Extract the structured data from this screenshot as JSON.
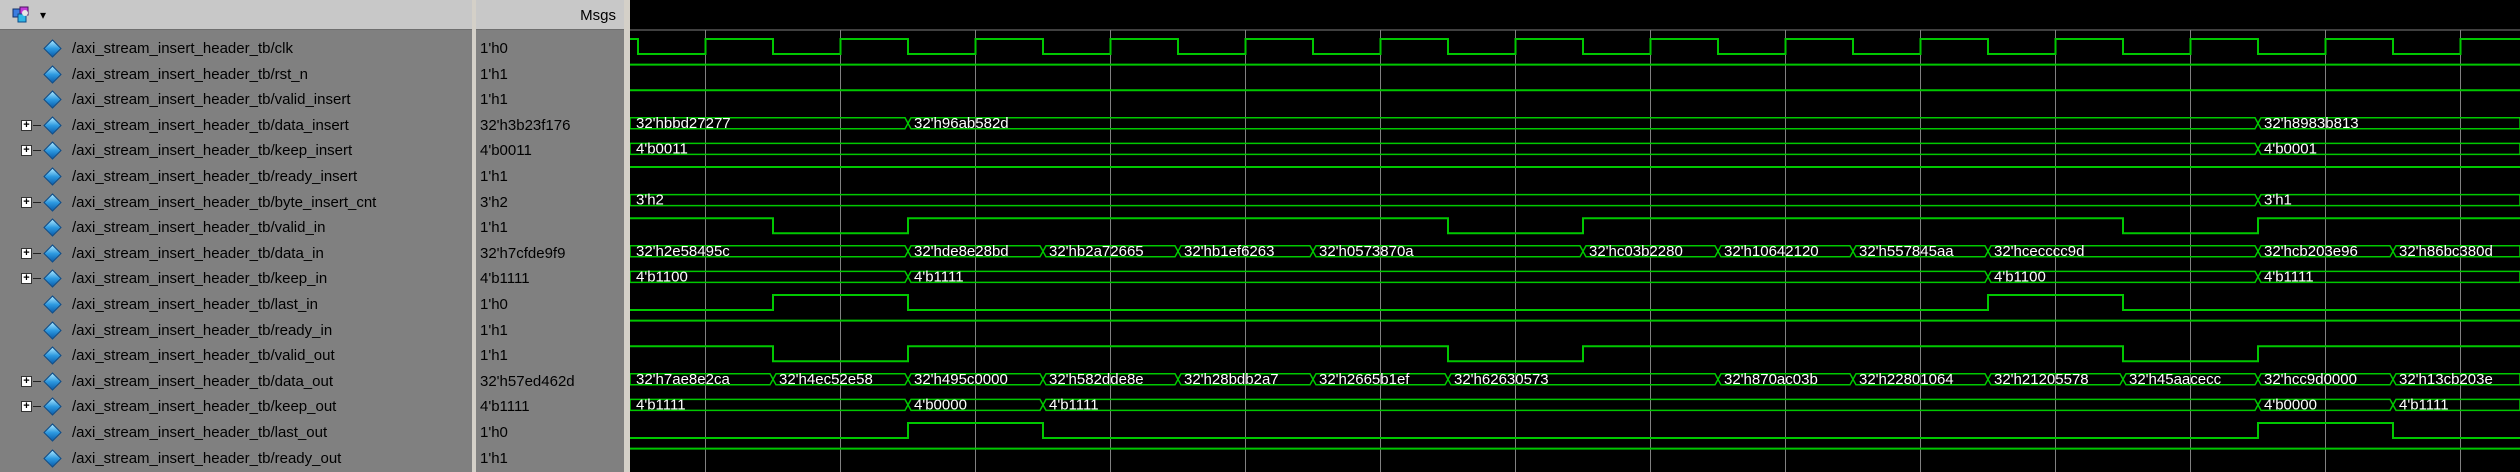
{
  "header": {
    "msgs_label": "Msgs"
  },
  "colors": {
    "wave": "#00c800",
    "grid": "#808080",
    "label": "#ffffff"
  },
  "icons": {
    "header": "wave-window-icon",
    "signal": "signal-diamond-icon",
    "expand": "expand-plus-icon"
  },
  "signals": [
    {
      "name": "/axi_stream_insert_header_tb/clk",
      "value": "1'h0",
      "bus": false
    },
    {
      "name": "/axi_stream_insert_header_tb/rst_n",
      "value": "1'h1",
      "bus": false
    },
    {
      "name": "/axi_stream_insert_header_tb/valid_insert",
      "value": "1'h1",
      "bus": false
    },
    {
      "name": "/axi_stream_insert_header_tb/data_insert",
      "value": "32'h3b23f176",
      "bus": true
    },
    {
      "name": "/axi_stream_insert_header_tb/keep_insert",
      "value": "4'b0011",
      "bus": true
    },
    {
      "name": "/axi_stream_insert_header_tb/ready_insert",
      "value": "1'h1",
      "bus": false
    },
    {
      "name": "/axi_stream_insert_header_tb/byte_insert_cnt",
      "value": "3'h2",
      "bus": true
    },
    {
      "name": "/axi_stream_insert_header_tb/valid_in",
      "value": "1'h1",
      "bus": false
    },
    {
      "name": "/axi_stream_insert_header_tb/data_in",
      "value": "32'h7cfde9f9",
      "bus": true
    },
    {
      "name": "/axi_stream_insert_header_tb/keep_in",
      "value": "4'b1111",
      "bus": true
    },
    {
      "name": "/axi_stream_insert_header_tb/last_in",
      "value": "1'h0",
      "bus": false
    },
    {
      "name": "/axi_stream_insert_header_tb/ready_in",
      "value": "1'h1",
      "bus": false
    },
    {
      "name": "/axi_stream_insert_header_tb/valid_out",
      "value": "1'h1",
      "bus": false
    },
    {
      "name": "/axi_stream_insert_header_tb/data_out",
      "value": "32'h57ed462d",
      "bus": true
    },
    {
      "name": "/axi_stream_insert_header_tb/keep_out",
      "value": "4'b1111",
      "bus": true
    },
    {
      "name": "/axi_stream_insert_header_tb/last_out",
      "value": "1'h0",
      "bus": false
    },
    {
      "name": "/axi_stream_insert_header_tb/ready_out",
      "value": "1'h1",
      "bus": false
    }
  ],
  "waves": [
    {
      "signal": "clk",
      "kind": "clock"
    },
    {
      "signal": "rst_n",
      "kind": "level",
      "edges": [
        [
          0,
          1
        ]
      ]
    },
    {
      "signal": "valid_insert",
      "kind": "level",
      "edges": [
        [
          0,
          1
        ]
      ]
    },
    {
      "signal": "data_insert",
      "kind": "bus",
      "segments": [
        [
          0,
          "32'hbbd27277"
        ],
        [
          4,
          "32'h96ab582d"
        ],
        [
          24,
          "32'h8983b813"
        ]
      ]
    },
    {
      "signal": "keep_insert",
      "kind": "bus",
      "segments": [
        [
          0,
          "4'b0011"
        ],
        [
          24,
          "4'b0001"
        ]
      ]
    },
    {
      "signal": "ready_insert",
      "kind": "level",
      "edges": [
        [
          0,
          1
        ]
      ]
    },
    {
      "signal": "byte_insert_cnt",
      "kind": "bus",
      "segments": [
        [
          0,
          "3'h2"
        ],
        [
          24,
          "3'h1"
        ]
      ]
    },
    {
      "signal": "valid_in",
      "kind": "level",
      "edges": [
        [
          0,
          1
        ],
        [
          2,
          0
        ],
        [
          4,
          1
        ],
        [
          12,
          0
        ],
        [
          14,
          1
        ],
        [
          22,
          0
        ],
        [
          24,
          1
        ]
      ]
    },
    {
      "signal": "data_in",
      "kind": "bus",
      "segments": [
        [
          0,
          "32'h2e58495c"
        ],
        [
          4,
          "32'hde8e28bd"
        ],
        [
          6,
          "32'hb2a72665"
        ],
        [
          8,
          "32'hb1ef6263"
        ],
        [
          10,
          "32'h0573870a"
        ],
        [
          14,
          "32'hc03b2280"
        ],
        [
          16,
          "32'h10642120"
        ],
        [
          18,
          "32'h557845aa"
        ],
        [
          20,
          "32'hcecccc9d"
        ],
        [
          24,
          "32'hcb203e96"
        ],
        [
          26,
          "32'h86bc380d"
        ]
      ]
    },
    {
      "signal": "keep_in",
      "kind": "bus",
      "segments": [
        [
          0,
          "4'b1100"
        ],
        [
          4,
          "4'b1111"
        ],
        [
          20,
          "4'b1100"
        ],
        [
          24,
          "4'b1111"
        ]
      ]
    },
    {
      "signal": "last_in",
      "kind": "level",
      "edges": [
        [
          0,
          0
        ],
        [
          2,
          1
        ],
        [
          4,
          0
        ],
        [
          20,
          1
        ],
        [
          22,
          0
        ]
      ]
    },
    {
      "signal": "ready_in",
      "kind": "level",
      "edges": [
        [
          0,
          1
        ]
      ]
    },
    {
      "signal": "valid_out",
      "kind": "level",
      "edges": [
        [
          0,
          1
        ],
        [
          2,
          0
        ],
        [
          4,
          1
        ],
        [
          12,
          0
        ],
        [
          14,
          1
        ],
        [
          22,
          0
        ],
        [
          24,
          1
        ]
      ]
    },
    {
      "signal": "data_out",
      "kind": "bus",
      "segments": [
        [
          0,
          "32'h7ae8e2ca"
        ],
        [
          2,
          "32'h4ec52e58"
        ],
        [
          4,
          "32'h495c0000"
        ],
        [
          6,
          "32'h582dde8e"
        ],
        [
          8,
          "32'h28bdb2a7"
        ],
        [
          10,
          "32'h2665b1ef"
        ],
        [
          12,
          "32'h62630573"
        ],
        [
          16,
          "32'h870ac03b"
        ],
        [
          18,
          "32'h22801064"
        ],
        [
          20,
          "32'h21205578"
        ],
        [
          22,
          "32'h45aacecc"
        ],
        [
          24,
          "32'hcc9d0000"
        ],
        [
          26,
          "32'h13cb203e"
        ]
      ]
    },
    {
      "signal": "keep_out",
      "kind": "bus",
      "segments": [
        [
          0,
          "4'b1111"
        ],
        [
          4,
          "4'b0000"
        ],
        [
          6,
          "4'b1111"
        ],
        [
          24,
          "4'b0000"
        ],
        [
          26,
          "4'b1111"
        ]
      ]
    },
    {
      "signal": "last_out",
      "kind": "level",
      "edges": [
        [
          0,
          0
        ],
        [
          4,
          1
        ],
        [
          6,
          0
        ],
        [
          24,
          1
        ],
        [
          26,
          0
        ]
      ]
    },
    {
      "signal": "ready_out",
      "kind": "level",
      "edges": [
        [
          0,
          1
        ]
      ]
    }
  ]
}
